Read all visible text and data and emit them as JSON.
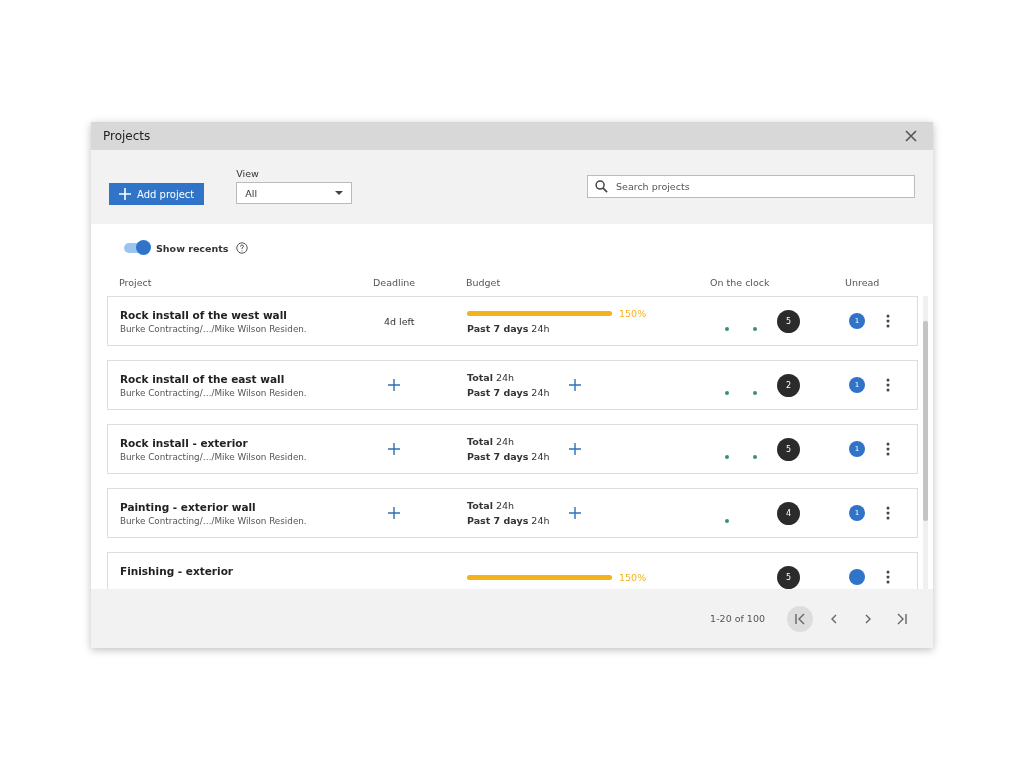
{
  "window": {
    "title": "Projects"
  },
  "toolbar": {
    "add_button": "Add project",
    "view": {
      "label": "View",
      "value": "All"
    },
    "search": {
      "placeholder": "Search projects"
    }
  },
  "show_recents": {
    "label": "Show recents",
    "on": true
  },
  "columns": [
    "Project",
    "Deadline",
    "Budget",
    "On the clock",
    "Unread"
  ],
  "rows": [
    {
      "title": "Rock install of the west wall",
      "subtitle": "Burke Contracting/…/Mike Wilson Residen.",
      "deadline": {
        "kind": "text",
        "text": "4d left"
      },
      "budget": {
        "kind": "bar",
        "level": 1,
        "percent": "150%",
        "lines": [
          {
            "label": "Past 7 days",
            "value": "24h"
          }
        ]
      },
      "activity": [
        {
          "kind": "dot"
        },
        {
          "kind": "dot"
        }
      ],
      "clock_count": "5",
      "unread": "1"
    },
    {
      "title": "Rock install of the east wall",
      "subtitle": "Burke Contracting/…/Mike Wilson Residen.",
      "deadline": {
        "kind": "add"
      },
      "budget": {
        "kind": "totals",
        "lines": [
          {
            "label": "Total",
            "value": "24h"
          },
          {
            "label": "Past 7 days",
            "value": "24h"
          }
        ]
      },
      "activity": [
        {
          "kind": "dot"
        },
        {
          "kind": "dot"
        }
      ],
      "clock_count": "2",
      "unread": "1"
    },
    {
      "title": "Rock install - exterior",
      "subtitle": "Burke Contracting/…/Mike Wilson Residen.",
      "deadline": {
        "kind": "add"
      },
      "budget": {
        "kind": "totals",
        "lines": [
          {
            "label": "Total",
            "value": "24h"
          },
          {
            "label": "Past 7 days",
            "value": "24h"
          }
        ]
      },
      "activity": [
        {
          "kind": "dot"
        },
        {
          "kind": "dot"
        }
      ],
      "clock_count": "5",
      "unread": "1"
    },
    {
      "title": "Painting - exterior wall",
      "subtitle": "Burke Contracting/…/Mike Wilson Residen.",
      "deadline": {
        "kind": "add"
      },
      "budget": {
        "kind": "totals",
        "lines": [
          {
            "label": "Total",
            "value": "24h"
          },
          {
            "label": "Past 7 days",
            "value": "24h"
          }
        ]
      },
      "activity": [
        {
          "kind": "dot"
        }
      ],
      "clock_count": "4",
      "unread": "1"
    },
    {
      "title": "Finishing - exterior",
      "deadline": {
        "kind": "none"
      },
      "budget": {
        "kind": "bar",
        "level": 1,
        "percent": "150%"
      },
      "activity": [],
      "clock_count": "5"
    }
  ],
  "pagination": {
    "range": "1-20 of 100"
  }
}
